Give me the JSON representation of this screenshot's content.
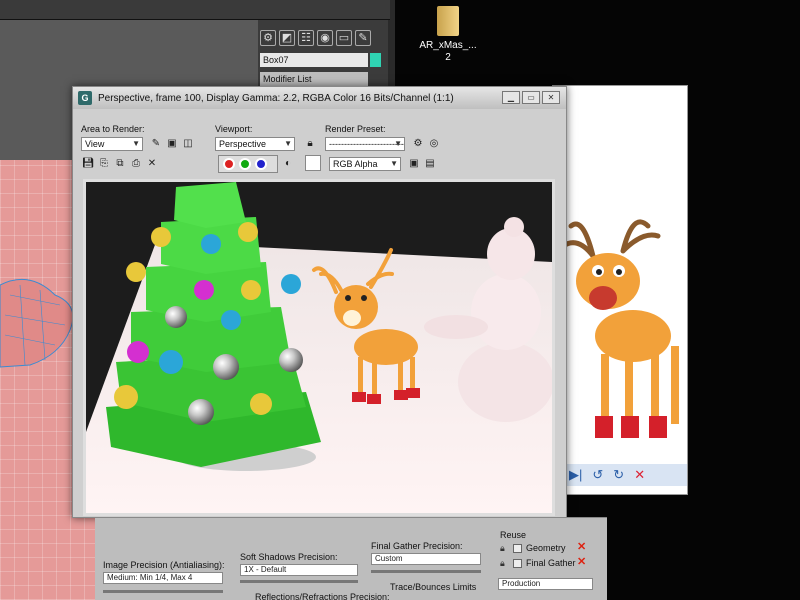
{
  "desktop": {
    "folder_label_line1": "AR_xMas_...",
    "folder_label_line2": "2"
  },
  "command_panel": {
    "object_name": "Box07",
    "object_color": "#2fd3b2",
    "modifier_list": "Modifier List",
    "icons": [
      "gear-icon",
      "create-icon",
      "hierarchy-icon",
      "motion-icon",
      "display-icon",
      "utilities-icon"
    ]
  },
  "render_window": {
    "title": "Perspective, frame 100, Display Gamma: 2.2, RGBA Color 16 Bits/Channel (1:1)",
    "app_icon": "G",
    "area_to_render_label": "Area to Render:",
    "area_to_render_value": "View",
    "viewport_label": "Viewport:",
    "viewport_value": "Perspective",
    "render_preset_label": "Render Preset:",
    "render_preset_value": "-------------------------",
    "channel_value": "RGB Alpha",
    "window_buttons": [
      "minimize",
      "restore",
      "close"
    ]
  },
  "rollout": {
    "image_precision_label": "Image Precision (Antialiasing):",
    "image_precision_value": "Medium: Min 1/4, Max 4",
    "soft_shadows_label": "Soft Shadows Precision:",
    "soft_shadows_value": "1X - Default",
    "final_gather_label": "Final Gather Precision:",
    "final_gather_value": "Custom",
    "trace_bounces_label": "Trace/Bounces Limits",
    "reflections_label": "Reflections/Refractions Precision:",
    "reuse_label": "Reuse",
    "geometry_label": "Geometry",
    "final_gather_reuse_label": "Final Gather",
    "preset_value": "Production"
  },
  "colors": {
    "tree_green": "#38c232",
    "reindeer_orange": "#f2a13a",
    "boot_red": "#d4202a",
    "floor_pink": "#e59a98"
  }
}
